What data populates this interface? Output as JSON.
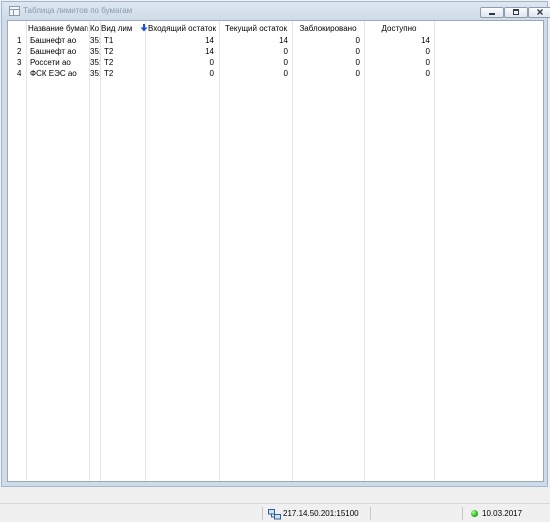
{
  "window": {
    "title": "Таблица лимитов по бумагам"
  },
  "table": {
    "columns": [
      "Название бумаги",
      "Ко",
      "Вид лим",
      "Входящий остаток",
      "Текущий остаток",
      "Заблокировано",
      "Доступно"
    ],
    "rows": [
      {
        "num": "1",
        "name": "Башнефт ао",
        "code": "35:",
        "limit_type": "T1",
        "incoming": "14",
        "current": "14",
        "blocked": "0",
        "available": "14"
      },
      {
        "num": "2",
        "name": "Башнефт ао",
        "code": "35:",
        "limit_type": "T2",
        "incoming": "14",
        "current": "0",
        "blocked": "0",
        "available": "0"
      },
      {
        "num": "3",
        "name": "Россети ао",
        "code": "35:",
        "limit_type": "T2",
        "incoming": "0",
        "current": "0",
        "blocked": "0",
        "available": "0"
      },
      {
        "num": "4",
        "name": "ФСК ЕЭС ао",
        "code": "35:",
        "limit_type": "T2",
        "incoming": "0",
        "current": "0",
        "blocked": "0",
        "available": "0"
      }
    ]
  },
  "statusbar": {
    "server": "217.14.50.201:15100",
    "date": "10.03.2017",
    "connection_color": "#22b414"
  },
  "icons": [
    "app-table-icon",
    "minimize-icon",
    "maximize-icon",
    "close-icon",
    "sort-down-arrow-icon",
    "network-icon",
    "connection-status-icon"
  ]
}
